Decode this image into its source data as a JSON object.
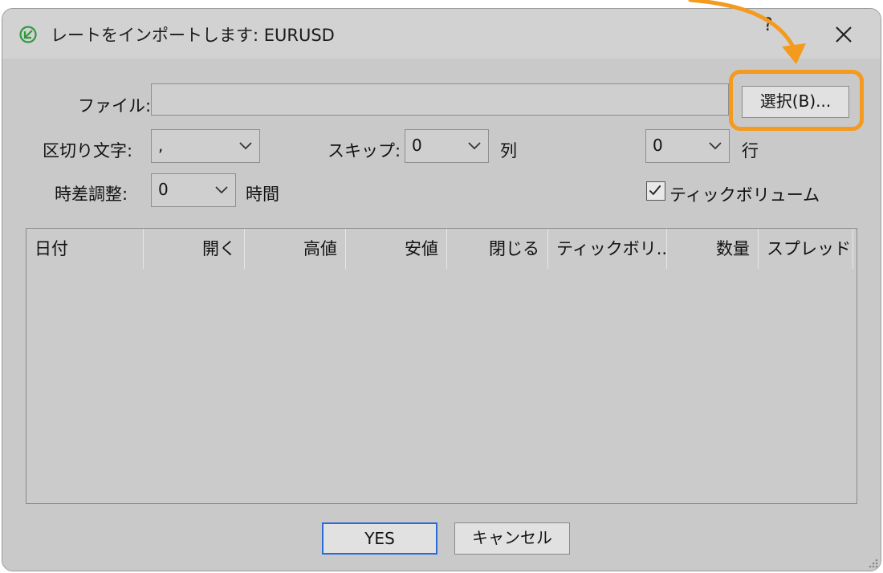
{
  "window": {
    "title": "レートをインポートします: EURUSD",
    "help_label": "?",
    "title_icon": "import-check-icon",
    "close_icon": "close-icon"
  },
  "form": {
    "file_label": "ファイル:",
    "file_value": "",
    "browse_label": "選択(B)...",
    "delimiter_label": "区切り文字:",
    "delimiter_value": ",",
    "skip_label": "スキップ:",
    "skip_columns_value": "0",
    "columns_unit": "列",
    "skip_rows_value": "0",
    "rows_unit": "行",
    "timezone_label": "時差調整:",
    "timezone_value": "0",
    "hours_unit": "時間",
    "tick_volume_label": "ティックボリューム",
    "tick_volume_checked": true
  },
  "table": {
    "columns": [
      "日付",
      "開く",
      "高値",
      "安値",
      "閉じる",
      "ティックボリ...",
      "数量",
      "スプレッド"
    ],
    "rows": []
  },
  "footer": {
    "yes_label": "YES",
    "cancel_label": "キャンセル"
  },
  "colors": {
    "highlight": "#f39a1f",
    "default_button_border": "#2a6bd6",
    "title_icon": "#2e9a3e"
  }
}
